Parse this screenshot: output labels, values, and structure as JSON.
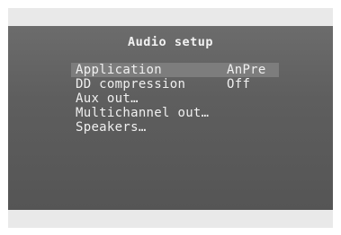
{
  "screen": {
    "title": "Audio setup",
    "menu": [
      {
        "label": "Application",
        "value": "AnPre",
        "selected": true
      },
      {
        "label": "DD compression",
        "value": "Off"
      },
      {
        "label": "Aux out…"
      },
      {
        "label": "Multichannel out…"
      },
      {
        "label": "Speakers…"
      }
    ]
  },
  "colors": {
    "background": "#5f5f5f",
    "highlight": "#7d7d7d",
    "text": "#f0f0f0",
    "bars": "#e9e9e9"
  }
}
